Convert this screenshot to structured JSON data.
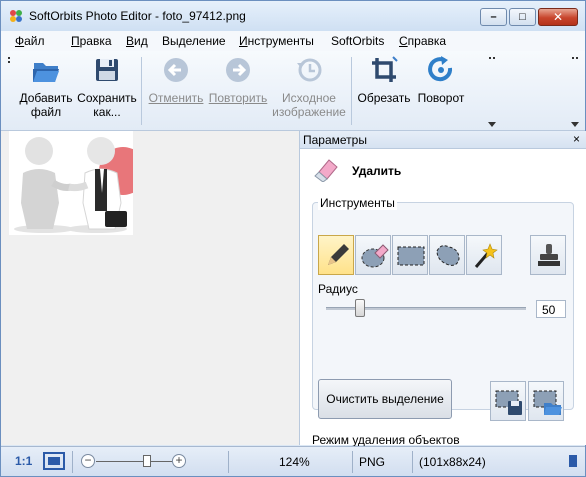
{
  "window": {
    "title": "SoftOrbits Photo Editor - foto_97412.png"
  },
  "menu": {
    "items": [
      {
        "pre": "",
        "u": "Ф",
        "post": "айл"
      },
      {
        "pre": "",
        "u": "П",
        "post": "равка"
      },
      {
        "pre": "",
        "u": "В",
        "post": "ид"
      },
      {
        "pre": "Выделение",
        "u": "",
        "post": ""
      },
      {
        "pre": "",
        "u": "И",
        "post": "нструменты"
      },
      {
        "pre": "SoftOrbits",
        "u": "",
        "post": ""
      },
      {
        "pre": "",
        "u": "С",
        "post": "правка"
      }
    ]
  },
  "toolbar": {
    "open": {
      "line1": "Добавить",
      "line2": "файл",
      "icon": "open-folder-icon"
    },
    "save": {
      "line1": "Сохранить",
      "line2": "как...",
      "icon": "save-floppy-icon"
    },
    "undo": {
      "line1": "Отменить",
      "icon": "undo-arrow-icon"
    },
    "redo": {
      "line1": "Повторить",
      "icon": "redo-arrow-icon"
    },
    "original": {
      "line1": "Исходное",
      "line2": "изображение",
      "icon": "original-clock-icon"
    },
    "crop": {
      "line1": "Обрезать",
      "icon": "crop-icon"
    },
    "rotate": {
      "line1": "Поворот",
      "icon": "rotate-icon"
    }
  },
  "params": {
    "header": "Параметры",
    "close": "×",
    "section_title": "Удалить",
    "tools_group": "Инструменты",
    "radius_label": "Радиус",
    "radius_value": "50",
    "radius_fraction": 0.17,
    "clear_button": "Очистить выделение",
    "mode_label": "Режим удаления объектов"
  },
  "status": {
    "zoom_one": "1:1",
    "zoom_percent": "124%",
    "format": "PNG",
    "dimensions": "(101x88x24)"
  },
  "colors": {
    "accent": "#2b5aa8",
    "active_tool": "#ffe28a",
    "close_button": "#c8452c"
  }
}
